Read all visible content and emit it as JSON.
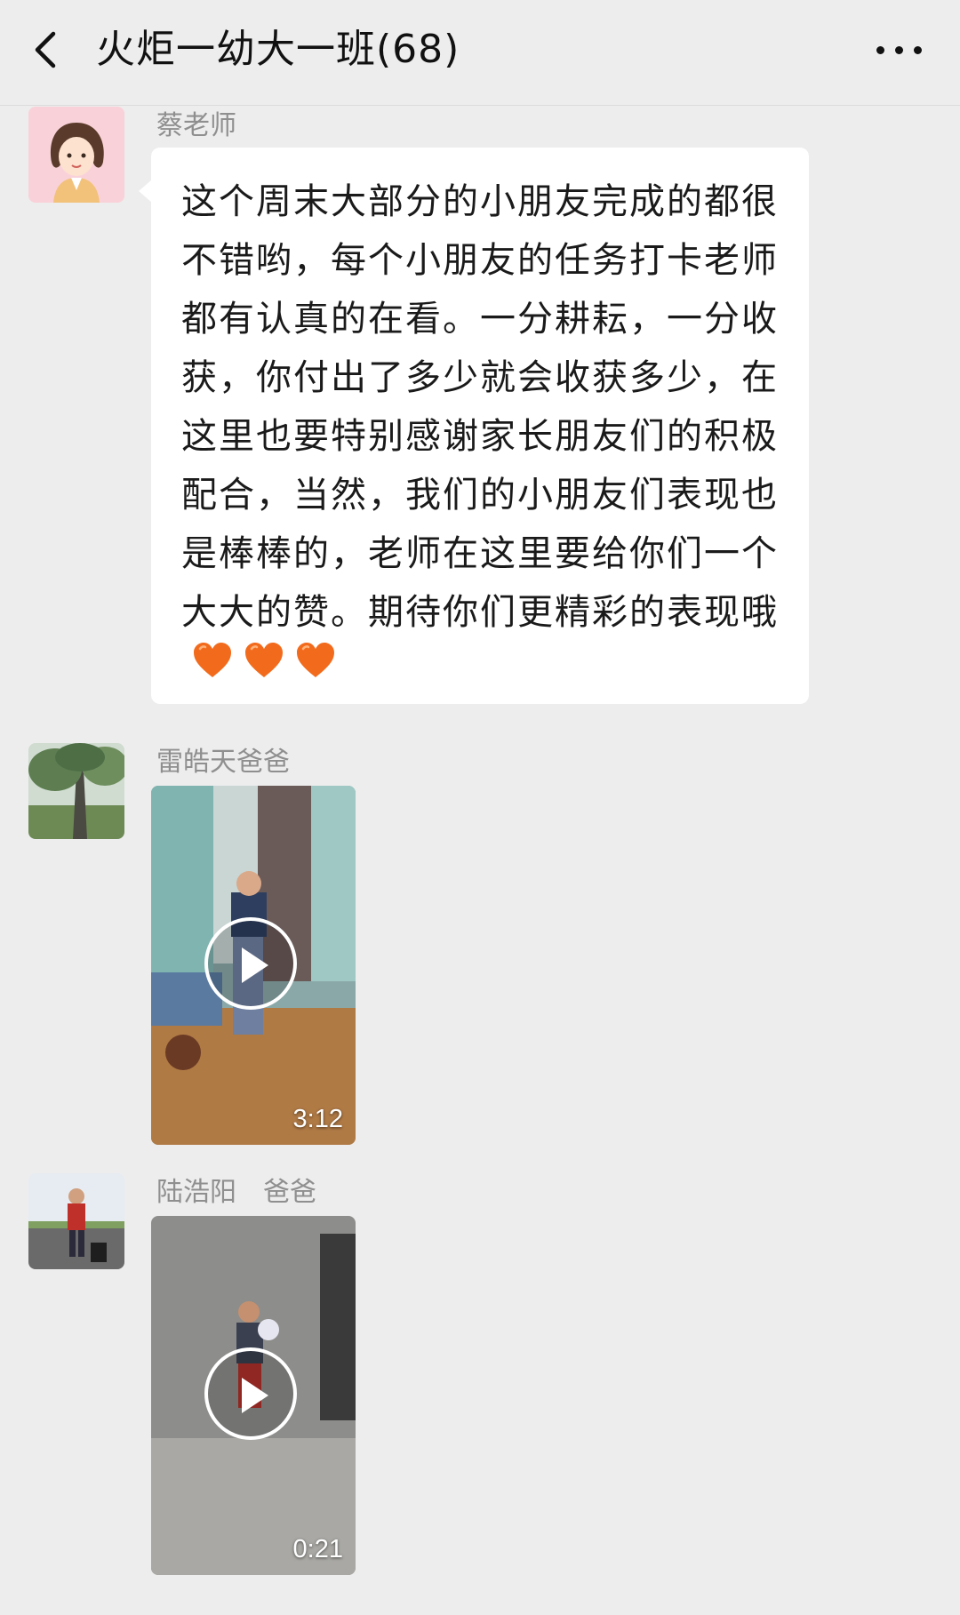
{
  "header": {
    "title": "火炬一幼大一班(68)",
    "back_icon": "chevron-left-icon",
    "more_icon": "more-dots-icon"
  },
  "messages": [
    {
      "sender": "蔡老师",
      "type": "text",
      "text": "这个周末大部分的小朋友完成的都很不错哟，每个小朋友的任务打卡老师都有认真的在看。一分耕耘，一分收获，你付出了多少就会收获多少，在这里也要特别感谢家长朋友们的积极配合，当然，我们的小朋友们表现也是棒棒的，老师在这里要给你们一个大大的赞。期待你们更精彩的表现哦",
      "emoji": [
        "orange-heart-icon",
        "orange-heart-icon",
        "orange-heart-icon"
      ]
    },
    {
      "sender": "雷皓天爸爸",
      "type": "video",
      "duration": "3:12"
    },
    {
      "sender": "陆浩阳　爸爸",
      "type": "video",
      "duration": "0:21"
    }
  ],
  "colors": {
    "background": "#ededed",
    "bubble": "#ffffff",
    "sender_name": "#8f8f8f",
    "heart": "#f26b1d"
  }
}
